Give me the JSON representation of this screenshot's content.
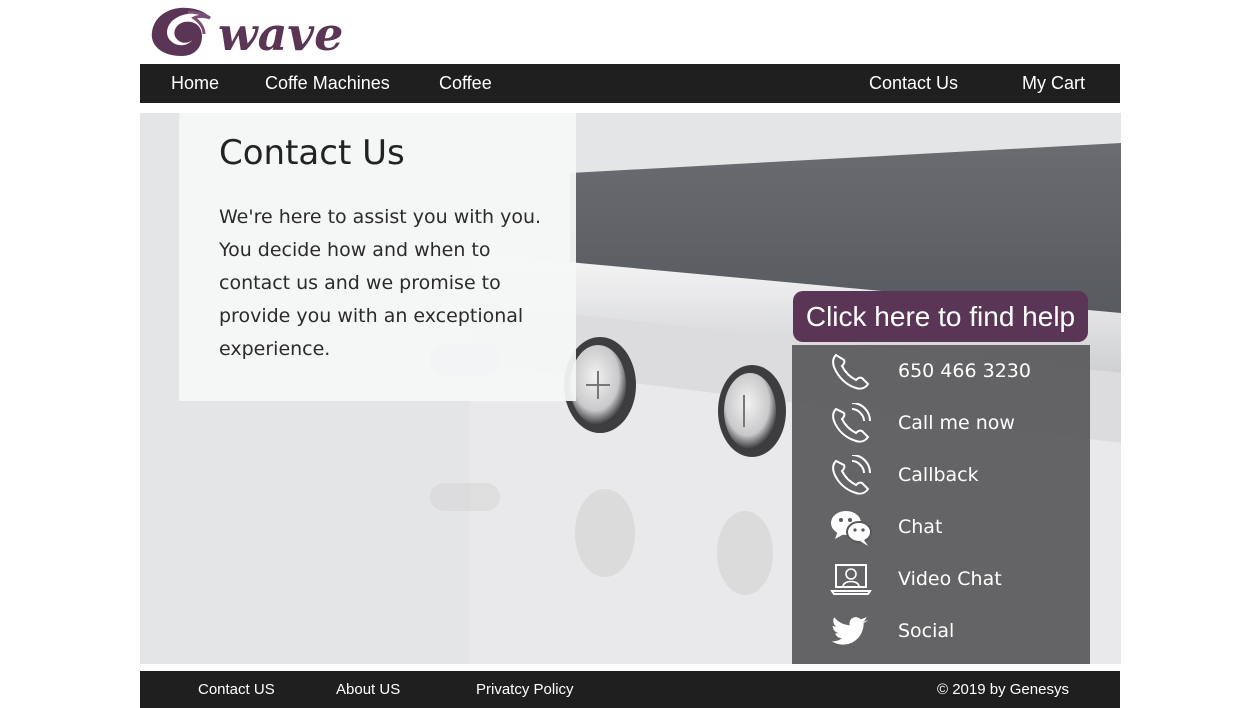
{
  "brand": {
    "logo_text": "wave",
    "logo_color": "#5b3556"
  },
  "nav": {
    "home": "Home",
    "coffee_machines": "Coffe Machines",
    "coffee": "Coffee",
    "contact_us": "Contact Us",
    "my_cart": "My Cart"
  },
  "contact": {
    "title": "Contact Us",
    "body": "We're here to assist you with you. You decide how and when to contact us and we promise to provide you with an exceptional experience."
  },
  "help": {
    "button_label": "Click here to find help",
    "items": [
      {
        "icon": "phone-icon",
        "label": "650 466 3230"
      },
      {
        "icon": "phone-ringing-icon",
        "label": "Call me now"
      },
      {
        "icon": "phone-ringing-icon",
        "label": "Callback"
      },
      {
        "icon": "chat-bubbles-icon",
        "label": "Chat"
      },
      {
        "icon": "video-chat-icon",
        "label": "Video Chat"
      },
      {
        "icon": "twitter-bird-icon",
        "label": "Social"
      }
    ]
  },
  "footer": {
    "contact": "Contact US",
    "about": "About US",
    "privacy": "Privatcy Policy",
    "copyright": "©  2019 by Genesys"
  },
  "colors": {
    "nav_bg": "#1f1f1f",
    "accent": "#5b3556",
    "panel_bg": "#58585a"
  }
}
